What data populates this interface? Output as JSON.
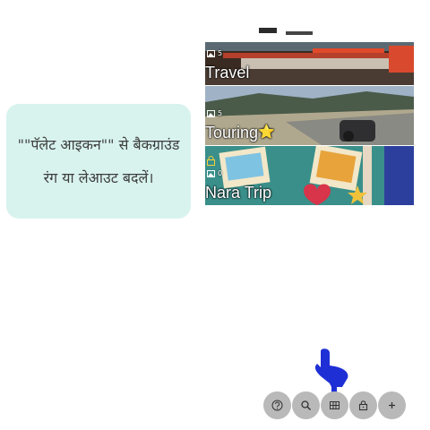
{
  "tip": {
    "text": "\"\"पॅलेट आइकन\"\" से बैकग्राउंड रंग या लेआउट बदलें।"
  },
  "albums": [
    {
      "title": "Travel",
      "count": "5"
    },
    {
      "title": "Touring",
      "badge": "⭐",
      "count": "5"
    },
    {
      "title": "Nara Trip",
      "count": "0",
      "locked": true
    }
  ],
  "toolbar": {
    "buttons": [
      {
        "icon": "help-icon"
      },
      {
        "icon": "search-icon"
      },
      {
        "icon": "palette-icon"
      },
      {
        "icon": "lock-icon"
      },
      {
        "icon": "add-icon"
      }
    ]
  },
  "colors": {
    "tip_bg": "#d8f3ee",
    "fab_bg": "#b9b9b9",
    "pointer": "#1f2fd6"
  }
}
